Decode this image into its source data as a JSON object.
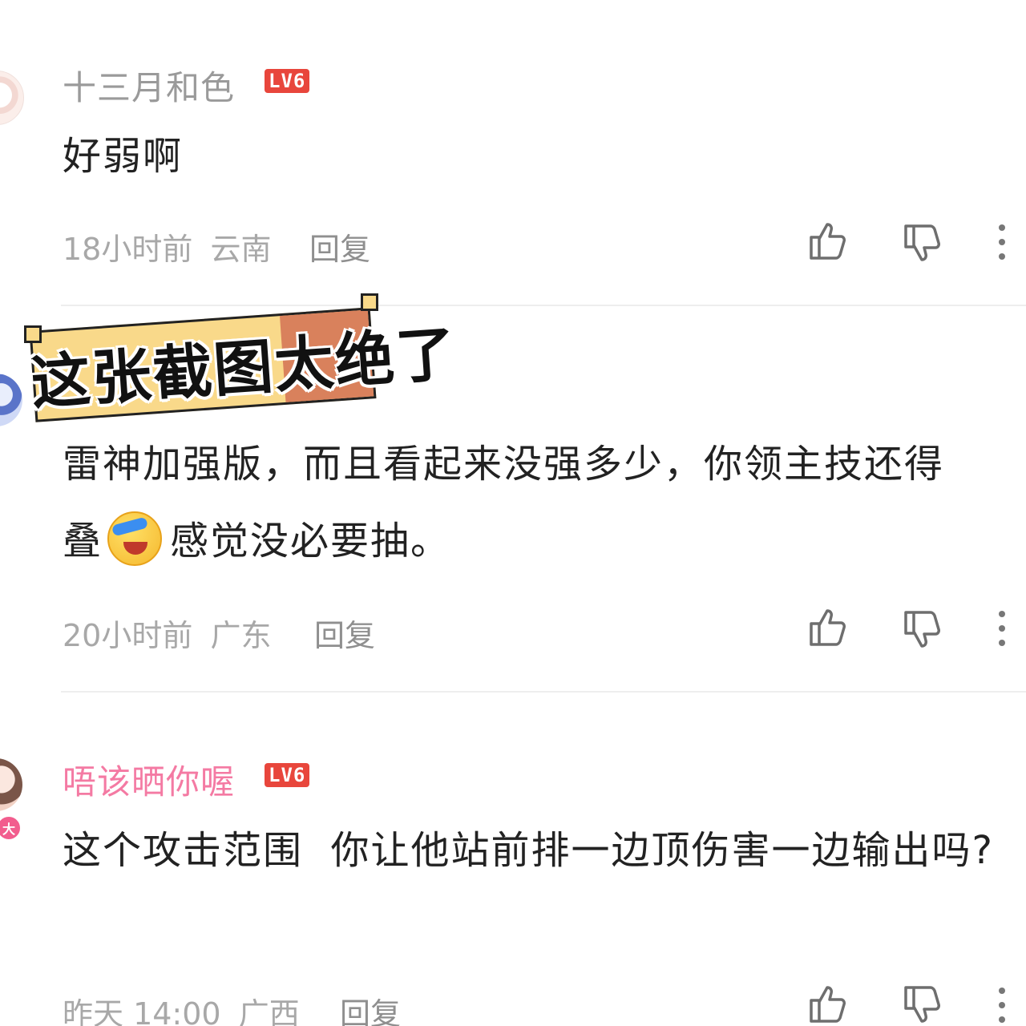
{
  "comments": [
    {
      "username": "十三月和色",
      "level": "LV6",
      "text": "好弱啊",
      "time": "18小时前",
      "location": "云南",
      "reply_label": "回复"
    },
    {
      "username": "",
      "text": "雷神加强版，而且看起来没强多少，你领主技还得",
      "text_line2_before": "叠",
      "text_line2_after": "感觉没必要抽。",
      "time": "20小时前",
      "location": "广东",
      "reply_label": "回复"
    },
    {
      "username": "唔该晒你喔",
      "level": "LV6",
      "avatar_badge": "大",
      "text": "这个攻击范围  你让他站前排一边顶伤害一边输出吗?",
      "time": "昨天 14:00",
      "location": "广西",
      "reply_label": "回复"
    }
  ],
  "overlay": {
    "caption": "这张截图太绝了"
  },
  "icons": {
    "like": "thumbs-up-icon",
    "dislike": "thumbs-down-icon",
    "more": "more-vertical-icon"
  },
  "colors": {
    "username_gray": "#9a9a9a",
    "username_pink": "#f47aa3",
    "level_badge": "#e8463c",
    "overlay_yellow": "#f9d98a",
    "overlay_orange": "#d9815c"
  }
}
